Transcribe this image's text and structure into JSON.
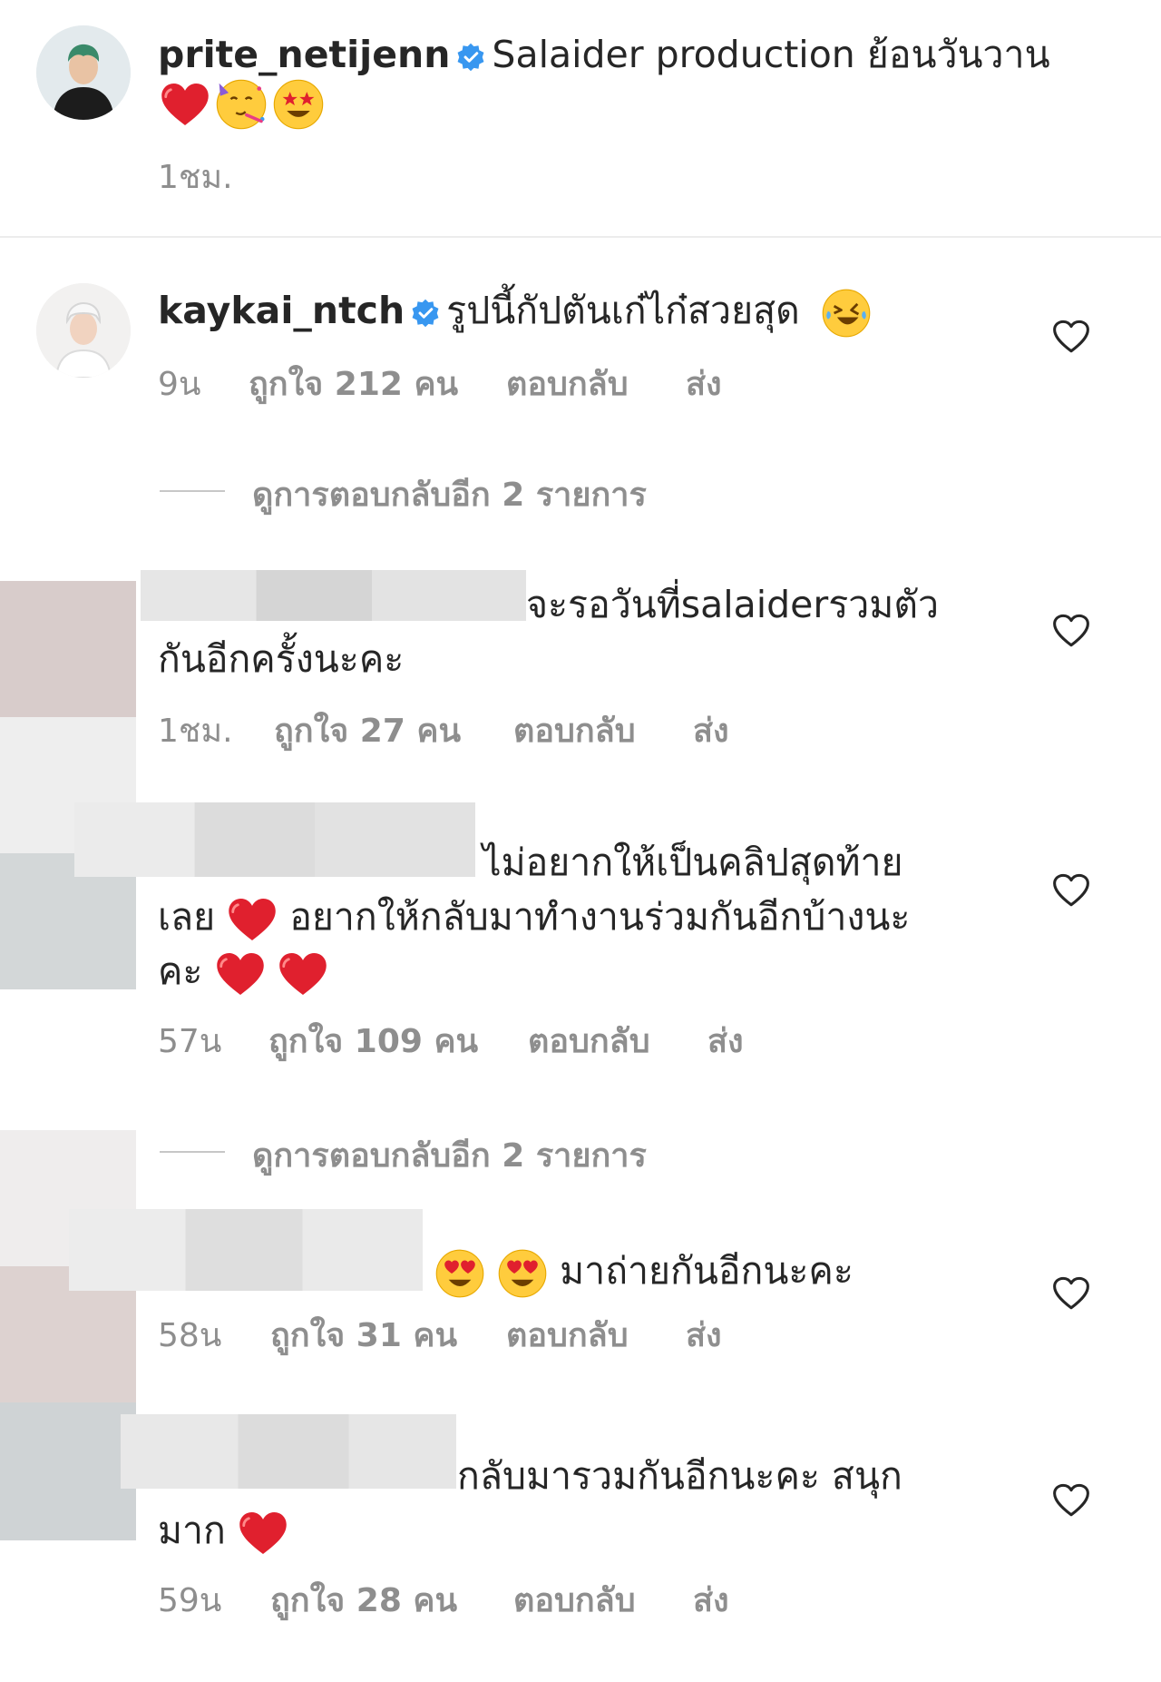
{
  "caption": {
    "username": "prite_netijenn",
    "text": "Salaider production ย้อนวันวาน",
    "emojis": [
      "red-heart",
      "partying-face",
      "star-struck"
    ],
    "time": "1ชม."
  },
  "comments": [
    {
      "username": "kaykai_ntch",
      "text": "รูปนี้กัปตันเก๋ไก๋สวยสุด",
      "emoji": "rolling-on-floor-laughing",
      "time": "9น",
      "likes": "ถูกใจ 212 คน",
      "reply": "ตอบกลับ",
      "send": "ส่ง",
      "view_replies": "ดูการตอบกลับอีก 2 รายการ"
    },
    {
      "line1": "จะรอวันที่salaiderรวมตัว",
      "line2": "กันอีกครั้งนะคะ",
      "time": "1ชม.",
      "likes": "ถูกใจ 27 คน",
      "reply": "ตอบกลับ",
      "send": "ส่ง"
    },
    {
      "line1": "ไม่อยากให้เป็นคลิปสุดท้าย",
      "line2a": "เลย",
      "line2b": "อยากให้กลับมาทำงานร่วมกันอีกบ้างนะ",
      "line3": "คะ",
      "time": "57น",
      "likes": "ถูกใจ 109 คน",
      "reply": "ตอบกลับ",
      "send": "ส่ง",
      "view_replies": "ดูการตอบกลับอีก 2 รายการ"
    },
    {
      "line1": "มาถ่ายกันอีกนะคะ",
      "emojis": [
        "heart-eyes",
        "heart-eyes"
      ],
      "time": "58น",
      "likes": "ถูกใจ 31 คน",
      "reply": "ตอบกลับ",
      "send": "ส่ง"
    },
    {
      "line1": "กลับมารวมกันอีกนะคะ สนุก",
      "line2": "มาก",
      "time": "59น",
      "likes": "ถูกใจ 28 คน",
      "reply": "ตอบกลับ",
      "send": "ส่ง"
    }
  ],
  "colors": {
    "verified": "#3897f0",
    "meta": "#8e8e8e",
    "heart": "#e0202e"
  },
  "icons": [
    "verified-badge-icon",
    "like-heart-icon",
    "red-heart-emoji",
    "partying-face-emoji",
    "star-struck-emoji",
    "laughing-emoji",
    "heart-eyes-emoji"
  ]
}
